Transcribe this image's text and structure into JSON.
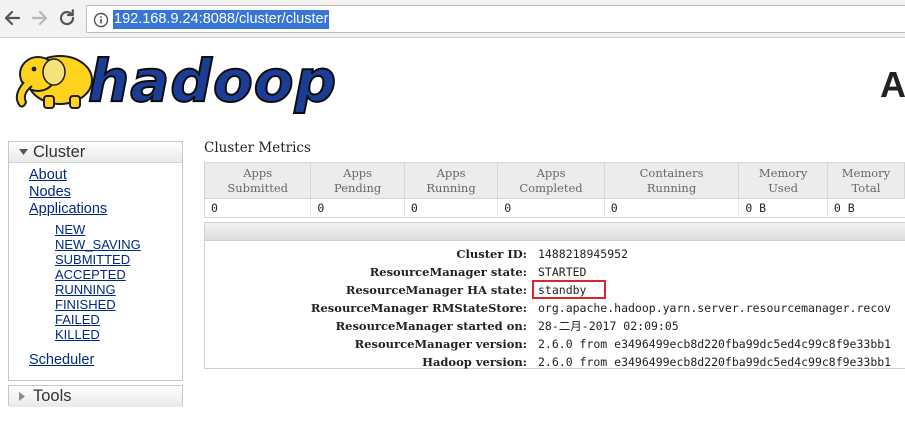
{
  "browser": {
    "url": "192.168.9.24:8088/cluster/cluster",
    "icons": {
      "back": "arrow-left-icon",
      "forward": "arrow-right-icon",
      "reload": "reload-icon",
      "info": "info-icon"
    }
  },
  "header": {
    "logo_text": "hadoop",
    "title_fragment": "A"
  },
  "sidebar": {
    "cluster_label": "Cluster",
    "links": [
      "About",
      "Nodes",
      "Applications"
    ],
    "app_states": [
      "NEW",
      "NEW_SAVING",
      "SUBMITTED",
      "ACCEPTED",
      "RUNNING",
      "FINISHED",
      "FAILED",
      "KILLED"
    ],
    "scheduler_label": "Scheduler",
    "tools_label": "Tools"
  },
  "metrics": {
    "title": "Cluster Metrics",
    "columns": [
      {
        "line1": "Apps",
        "line2": "Submitted",
        "value": "0"
      },
      {
        "line1": "Apps",
        "line2": "Pending",
        "value": "0"
      },
      {
        "line1": "Apps",
        "line2": "Running",
        "value": "0"
      },
      {
        "line1": "Apps",
        "line2": "Completed",
        "value": "0"
      },
      {
        "line1": "Containers",
        "line2": "Running",
        "value": "0"
      },
      {
        "line1": "Memory",
        "line2": "Used",
        "value": "0 B"
      },
      {
        "line1": "Memory",
        "line2": "Total",
        "value": "0 B"
      }
    ]
  },
  "cluster_info": {
    "rows": [
      {
        "label": "Cluster ID:",
        "value": "1488218945952"
      },
      {
        "label": "ResourceManager state:",
        "value": "STARTED"
      },
      {
        "label": "ResourceManager HA state:",
        "value": "standby"
      },
      {
        "label": "ResourceManager RMStateStore:",
        "value": "org.apache.hadoop.yarn.server.resourcemanager.recov"
      },
      {
        "label": "ResourceManager started on:",
        "value": "28-二月-2017 02:09:05"
      },
      {
        "label": "ResourceManager version:",
        "value": "2.6.0 from e3496499ecb8d220fba99dc5ed4c99c8f9e33bb1"
      },
      {
        "label": "Hadoop version:",
        "value": "2.6.0 from e3496499ecb8d220fba99dc5ed4c99c8f9e33bb1"
      }
    ]
  },
  "colors": {
    "url_highlight": "#3875d7",
    "link": "#002a80",
    "annotation_box": "#d9262c",
    "logo_yellow": "#ffd21e",
    "logo_blue": "#1c3d96"
  }
}
